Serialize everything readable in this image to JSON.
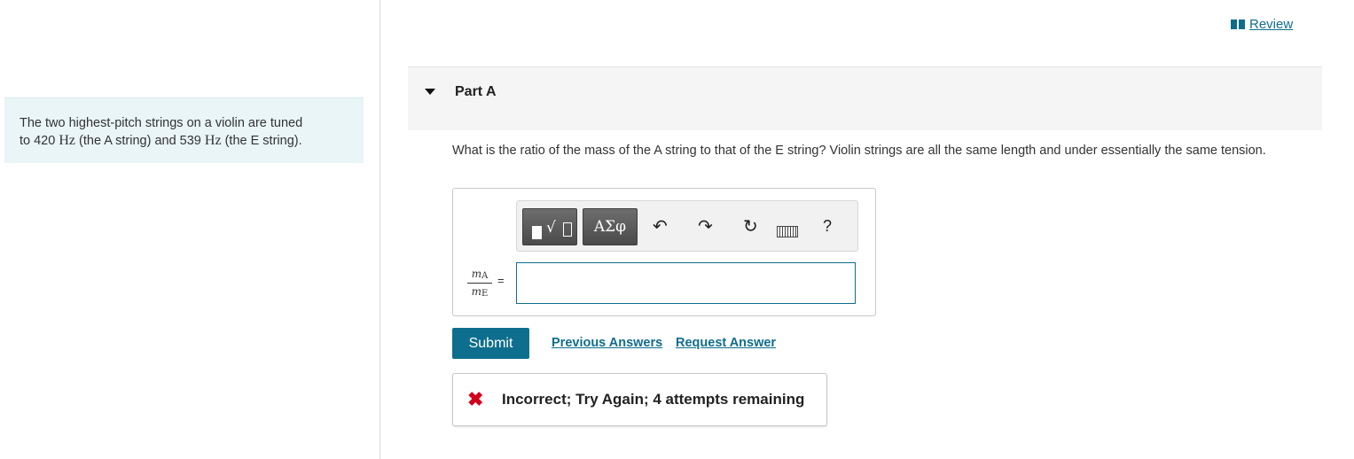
{
  "review": {
    "label": "Review",
    "icon": "book-icon"
  },
  "problem": {
    "text_1": "The two highest-pitch strings on a violin are tuned",
    "text_2a": "to 420 ",
    "unit": "Hz",
    "text_2b": " (the A string) and 539 ",
    "text_2c": " (the E string)."
  },
  "part": {
    "title": "Part A"
  },
  "question": {
    "text": "What is the ratio of the mass of the A string to that of the E string? Violin strings are all the same length and under essentially the same tension."
  },
  "toolbar": {
    "greek_label": "ΑΣφ",
    "undo_icon": "↶",
    "redo_icon": "↷",
    "reset_icon": "↻",
    "help_label": "?"
  },
  "formula": {
    "numerator": "m",
    "numerator_sub": "A",
    "denominator": "m",
    "denominator_sub": "E",
    "equals": "="
  },
  "answer": {
    "value": ""
  },
  "actions": {
    "submit_label": "Submit",
    "previous_label": "Previous Answers",
    "request_label": "Request Answer"
  },
  "feedback": {
    "icon": "✖",
    "text": "Incorrect; Try Again; 4 attempts remaining"
  },
  "colors": {
    "accent": "#0e6e8d",
    "error": "#d0021b",
    "problem_bg": "#e9f5f7"
  }
}
